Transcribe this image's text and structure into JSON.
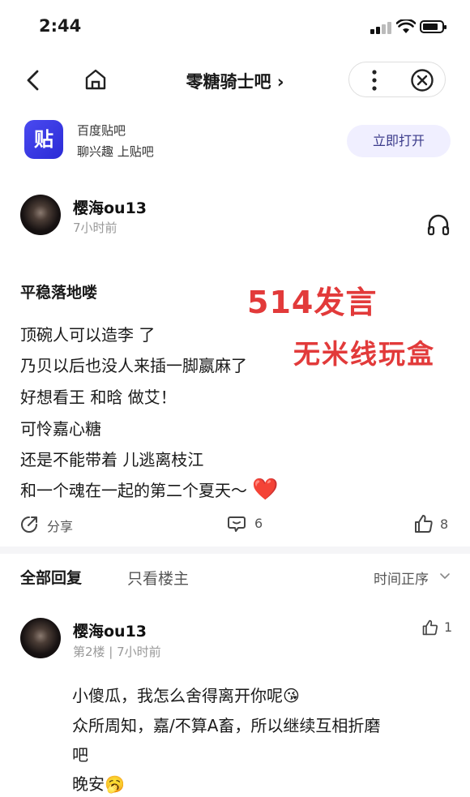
{
  "status_bar": {
    "time": "2:44"
  },
  "nav": {
    "title": "零糖骑士吧 ›"
  },
  "banner": {
    "logo_text": "贴",
    "app_name": "百度贴吧",
    "slogan": "聊兴趣 上贴吧",
    "open_label": "立即打开"
  },
  "post": {
    "author": "樱海ou13",
    "time": "7小时前",
    "title": "平稳落地喽",
    "overlay_text_1": "514发言",
    "overlay_text_2": "无米线玩盒",
    "lines": [
      "顶碗人可以造李 了",
      "乃贝以后也没人来插一脚嬴麻了",
      "好想看王  和晗    做艾！",
      "可怜嘉心糖",
      "还是不能带着 儿逃离枝江",
      "和一个魂在一起的第二个夏天～"
    ],
    "heart": "❤️",
    "share_label": "分享",
    "comment_count": "6",
    "like_count": "8"
  },
  "replies_header": {
    "tab_all": "全部回复",
    "tab_owner": "只看楼主",
    "sort_label": "时间正序"
  },
  "reply": {
    "author": "樱海ou13",
    "meta": "第2楼 | 7小时前",
    "like_count": "1",
    "lines": [
      "小傻瓜，我怎么舍得离开你呢",
      "众所周知，嘉/不算A畜，所以继续互相折磨",
      "吧",
      "晚安"
    ],
    "emoji_1": "😘",
    "emoji_2": "🥱"
  }
}
